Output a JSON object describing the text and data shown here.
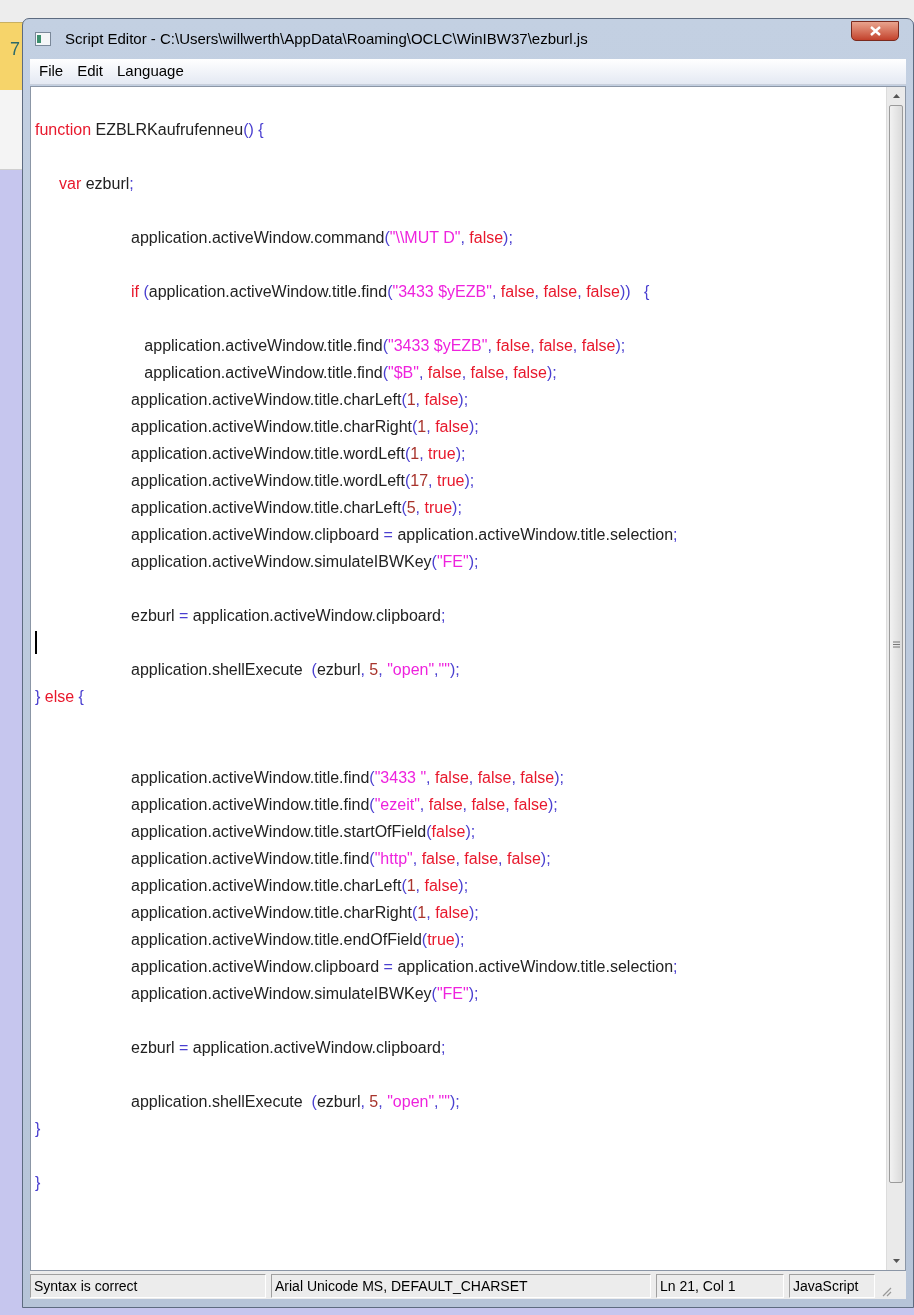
{
  "background_window": {
    "text": "7"
  },
  "window": {
    "title": "Script Editor - C:\\Users\\willwerth\\AppData\\Roaming\\OCLC\\WinIBW37\\ezburl.js"
  },
  "menu": [
    "File",
    "Edit",
    "Language"
  ],
  "editor": {
    "lines": [
      {
        "caret": false,
        "tokens": [
          {
            "kind": "keyword",
            "text": "function"
          },
          {
            "kind": "plain",
            "text": " EZBLRKaufrufenneu"
          },
          {
            "kind": "punct",
            "text": "() {"
          }
        ]
      },
      {
        "caret": false
      },
      {
        "caret": false,
        "tokens": [
          {
            "kind": "keyword",
            "text": "\tvar"
          },
          {
            "kind": "plain",
            "text": " ezburl"
          },
          {
            "kind": "punct",
            "text": ";"
          }
        ]
      },
      {
        "caret": false
      },
      {
        "caret": false,
        "tokens": [
          {
            "kind": "plain",
            "text": "\t\t\t\tapplication.activeWindow.command"
          },
          {
            "kind": "punct",
            "text": "("
          },
          {
            "kind": "string",
            "text": "\"\\\\MUT D\""
          },
          {
            "kind": "punct",
            "text": ", "
          },
          {
            "kind": "literal",
            "text": "false"
          },
          {
            "kind": "punct",
            "text": ");"
          }
        ]
      },
      {
        "caret": false
      },
      {
        "caret": false,
        "tokens": [
          {
            "kind": "keyword",
            "text": "\t\t\t\tif"
          },
          {
            "kind": "punct",
            "text": " ("
          },
          {
            "kind": "plain",
            "text": "application.activeWindow.title.find"
          },
          {
            "kind": "punct",
            "text": "("
          },
          {
            "kind": "string",
            "text": "\"3433 $yEZB\""
          },
          {
            "kind": "punct",
            "text": ", "
          },
          {
            "kind": "literal",
            "text": "false"
          },
          {
            "kind": "punct",
            "text": ", "
          },
          {
            "kind": "literal",
            "text": "false"
          },
          {
            "kind": "punct",
            "text": ", "
          },
          {
            "kind": "literal",
            "text": "false"
          },
          {
            "kind": "punct",
            "text": "))   {"
          }
        ]
      },
      {
        "caret": false
      },
      {
        "caret": false,
        "tokens": [
          {
            "kind": "plain",
            "text": "\t\t\t\t   application.activeWindow.title.find"
          },
          {
            "kind": "punct",
            "text": "("
          },
          {
            "kind": "string",
            "text": "\"3433 $yEZB\""
          },
          {
            "kind": "punct",
            "text": ", "
          },
          {
            "kind": "literal",
            "text": "false"
          },
          {
            "kind": "punct",
            "text": ", "
          },
          {
            "kind": "literal",
            "text": "false"
          },
          {
            "kind": "punct",
            "text": ", "
          },
          {
            "kind": "literal",
            "text": "false"
          },
          {
            "kind": "punct",
            "text": ");"
          }
        ]
      },
      {
        "caret": false,
        "tokens": [
          {
            "kind": "plain",
            "text": "\t\t\t\t   application.activeWindow.title.find"
          },
          {
            "kind": "punct",
            "text": "("
          },
          {
            "kind": "string",
            "text": "\"$B\""
          },
          {
            "kind": "punct",
            "text": ", "
          },
          {
            "kind": "literal",
            "text": "false"
          },
          {
            "kind": "punct",
            "text": ", "
          },
          {
            "kind": "literal",
            "text": "false"
          },
          {
            "kind": "punct",
            "text": ", "
          },
          {
            "kind": "literal",
            "text": "false"
          },
          {
            "kind": "punct",
            "text": ");"
          }
        ]
      },
      {
        "caret": false,
        "tokens": [
          {
            "kind": "plain",
            "text": "\t\t\t\tapplication.activeWindow.title.charLeft"
          },
          {
            "kind": "punct",
            "text": "("
          },
          {
            "kind": "number",
            "text": "1"
          },
          {
            "kind": "punct",
            "text": ", "
          },
          {
            "kind": "literal",
            "text": "false"
          },
          {
            "kind": "punct",
            "text": ");"
          }
        ]
      },
      {
        "caret": false,
        "tokens": [
          {
            "kind": "plain",
            "text": "\t\t\t\tapplication.activeWindow.title.charRight"
          },
          {
            "kind": "punct",
            "text": "("
          },
          {
            "kind": "number",
            "text": "1"
          },
          {
            "kind": "punct",
            "text": ", "
          },
          {
            "kind": "literal",
            "text": "false"
          },
          {
            "kind": "punct",
            "text": ");"
          }
        ]
      },
      {
        "caret": false,
        "tokens": [
          {
            "kind": "plain",
            "text": "\t\t\t\tapplication.activeWindow.title.wordLeft"
          },
          {
            "kind": "punct",
            "text": "("
          },
          {
            "kind": "number",
            "text": "1"
          },
          {
            "kind": "punct",
            "text": ", "
          },
          {
            "kind": "literal",
            "text": "true"
          },
          {
            "kind": "punct",
            "text": ");"
          }
        ]
      },
      {
        "caret": false,
        "tokens": [
          {
            "kind": "plain",
            "text": "\t\t\t\tapplication.activeWindow.title.wordLeft"
          },
          {
            "kind": "punct",
            "text": "("
          },
          {
            "kind": "number",
            "text": "17"
          },
          {
            "kind": "punct",
            "text": ", "
          },
          {
            "kind": "literal",
            "text": "true"
          },
          {
            "kind": "punct",
            "text": ");"
          }
        ]
      },
      {
        "caret": false,
        "tokens": [
          {
            "kind": "plain",
            "text": "\t\t\t\tapplication.activeWindow.title.charLeft"
          },
          {
            "kind": "punct",
            "text": "("
          },
          {
            "kind": "number",
            "text": "5"
          },
          {
            "kind": "punct",
            "text": ", "
          },
          {
            "kind": "literal",
            "text": "true"
          },
          {
            "kind": "punct",
            "text": ");"
          }
        ]
      },
      {
        "caret": false,
        "tokens": [
          {
            "kind": "plain",
            "text": "\t\t\t\tapplication.activeWindow.clipboard "
          },
          {
            "kind": "punct",
            "text": "="
          },
          {
            "kind": "plain",
            "text": " application.activeWindow.title.selection"
          },
          {
            "kind": "punct",
            "text": ";"
          }
        ]
      },
      {
        "caret": false,
        "tokens": [
          {
            "kind": "plain",
            "text": "\t\t\t\tapplication.activeWindow.simulateIBWKey"
          },
          {
            "kind": "punct",
            "text": "("
          },
          {
            "kind": "string",
            "text": "\"FE\""
          },
          {
            "kind": "punct",
            "text": ");"
          }
        ]
      },
      {
        "caret": false
      },
      {
        "caret": false,
        "tokens": [
          {
            "kind": "plain",
            "text": "\t\t\t\tezburl "
          },
          {
            "kind": "punct",
            "text": "="
          },
          {
            "kind": "plain",
            "text": " application.activeWindow.clipboard"
          },
          {
            "kind": "punct",
            "text": ";"
          }
        ]
      },
      {
        "caret": true
      },
      {
        "caret": false,
        "tokens": [
          {
            "kind": "plain",
            "text": "\t\t\t\tapplication.shellExecute  "
          },
          {
            "kind": "punct",
            "text": "("
          },
          {
            "kind": "plain",
            "text": "ezburl"
          },
          {
            "kind": "punct",
            "text": ", "
          },
          {
            "kind": "number",
            "text": "5"
          },
          {
            "kind": "punct",
            "text": ", "
          },
          {
            "kind": "string",
            "text": "\"open\""
          },
          {
            "kind": "punct",
            "text": ","
          },
          {
            "kind": "string",
            "text": "\"\""
          },
          {
            "kind": "punct",
            "text": ");"
          }
        ]
      },
      {
        "caret": false,
        "tokens": [
          {
            "kind": "punct",
            "text": "} "
          },
          {
            "kind": "keyword",
            "text": "else"
          },
          {
            "kind": "punct",
            "text": " {"
          }
        ]
      },
      {
        "caret": false
      },
      {
        "caret": false
      },
      {
        "caret": false,
        "tokens": [
          {
            "kind": "plain",
            "text": "\t\t\t\tapplication.activeWindow.title.find"
          },
          {
            "kind": "punct",
            "text": "("
          },
          {
            "kind": "string",
            "text": "\"3433 \""
          },
          {
            "kind": "punct",
            "text": ", "
          },
          {
            "kind": "literal",
            "text": "false"
          },
          {
            "kind": "punct",
            "text": ", "
          },
          {
            "kind": "literal",
            "text": "false"
          },
          {
            "kind": "punct",
            "text": ", "
          },
          {
            "kind": "literal",
            "text": "false"
          },
          {
            "kind": "punct",
            "text": ");"
          }
        ]
      },
      {
        "caret": false,
        "tokens": [
          {
            "kind": "plain",
            "text": "\t\t\t\tapplication.activeWindow.title.find"
          },
          {
            "kind": "punct",
            "text": "("
          },
          {
            "kind": "string",
            "text": "\"ezeit\""
          },
          {
            "kind": "punct",
            "text": ", "
          },
          {
            "kind": "literal",
            "text": "false"
          },
          {
            "kind": "punct",
            "text": ", "
          },
          {
            "kind": "literal",
            "text": "false"
          },
          {
            "kind": "punct",
            "text": ", "
          },
          {
            "kind": "literal",
            "text": "false"
          },
          {
            "kind": "punct",
            "text": ");"
          }
        ]
      },
      {
        "caret": false,
        "tokens": [
          {
            "kind": "plain",
            "text": "\t\t\t\tapplication.activeWindow.title.startOfField"
          },
          {
            "kind": "punct",
            "text": "("
          },
          {
            "kind": "literal",
            "text": "false"
          },
          {
            "kind": "punct",
            "text": ");"
          }
        ]
      },
      {
        "caret": false,
        "tokens": [
          {
            "kind": "plain",
            "text": "\t\t\t\tapplication.activeWindow.title.find"
          },
          {
            "kind": "punct",
            "text": "("
          },
          {
            "kind": "string",
            "text": "\"http\""
          },
          {
            "kind": "punct",
            "text": ", "
          },
          {
            "kind": "literal",
            "text": "false"
          },
          {
            "kind": "punct",
            "text": ", "
          },
          {
            "kind": "literal",
            "text": "false"
          },
          {
            "kind": "punct",
            "text": ", "
          },
          {
            "kind": "literal",
            "text": "false"
          },
          {
            "kind": "punct",
            "text": ");"
          }
        ]
      },
      {
        "caret": false,
        "tokens": [
          {
            "kind": "plain",
            "text": "\t\t\t\tapplication.activeWindow.title.charLeft"
          },
          {
            "kind": "punct",
            "text": "("
          },
          {
            "kind": "number",
            "text": "1"
          },
          {
            "kind": "punct",
            "text": ", "
          },
          {
            "kind": "literal",
            "text": "false"
          },
          {
            "kind": "punct",
            "text": ");"
          }
        ]
      },
      {
        "caret": false,
        "tokens": [
          {
            "kind": "plain",
            "text": "\t\t\t\tapplication.activeWindow.title.charRight"
          },
          {
            "kind": "punct",
            "text": "("
          },
          {
            "kind": "number",
            "text": "1"
          },
          {
            "kind": "punct",
            "text": ", "
          },
          {
            "kind": "literal",
            "text": "false"
          },
          {
            "kind": "punct",
            "text": ");"
          }
        ]
      },
      {
        "caret": false,
        "tokens": [
          {
            "kind": "plain",
            "text": "\t\t\t\tapplication.activeWindow.title.endOfField"
          },
          {
            "kind": "punct",
            "text": "("
          },
          {
            "kind": "literal",
            "text": "true"
          },
          {
            "kind": "punct",
            "text": ");"
          }
        ]
      },
      {
        "caret": false,
        "tokens": [
          {
            "kind": "plain",
            "text": "\t\t\t\tapplication.activeWindow.clipboard "
          },
          {
            "kind": "punct",
            "text": "="
          },
          {
            "kind": "plain",
            "text": " application.activeWindow.title.selection"
          },
          {
            "kind": "punct",
            "text": ";"
          }
        ]
      },
      {
        "caret": false,
        "tokens": [
          {
            "kind": "plain",
            "text": "\t\t\t\tapplication.activeWindow.simulateIBWKey"
          },
          {
            "kind": "punct",
            "text": "("
          },
          {
            "kind": "string",
            "text": "\"FE\""
          },
          {
            "kind": "punct",
            "text": ");"
          }
        ]
      },
      {
        "caret": false
      },
      {
        "caret": false,
        "tokens": [
          {
            "kind": "plain",
            "text": "\t\t\t\tezburl "
          },
          {
            "kind": "punct",
            "text": "="
          },
          {
            "kind": "plain",
            "text": " application.activeWindow.clipboard"
          },
          {
            "kind": "punct",
            "text": ";"
          }
        ]
      },
      {
        "caret": false
      },
      {
        "caret": false,
        "tokens": [
          {
            "kind": "plain",
            "text": "\t\t\t\tapplication.shellExecute  "
          },
          {
            "kind": "punct",
            "text": "("
          },
          {
            "kind": "plain",
            "text": "ezburl"
          },
          {
            "kind": "punct",
            "text": ", "
          },
          {
            "kind": "number",
            "text": "5"
          },
          {
            "kind": "punct",
            "text": ", "
          },
          {
            "kind": "string",
            "text": "\"open\""
          },
          {
            "kind": "punct",
            "text": ","
          },
          {
            "kind": "string",
            "text": "\"\""
          },
          {
            "kind": "punct",
            "text": ");"
          }
        ]
      },
      {
        "caret": false,
        "tokens": [
          {
            "kind": "punct",
            "text": "}"
          }
        ]
      },
      {
        "caret": false
      },
      {
        "caret": false,
        "tokens": [
          {
            "kind": "punct",
            "text": "}"
          }
        ]
      }
    ]
  },
  "status_bar": [
    "Syntax is correct",
    "Arial Unicode MS, DEFAULT_CHARSET",
    "Ln 21, Col 1",
    "JavaScript"
  ]
}
